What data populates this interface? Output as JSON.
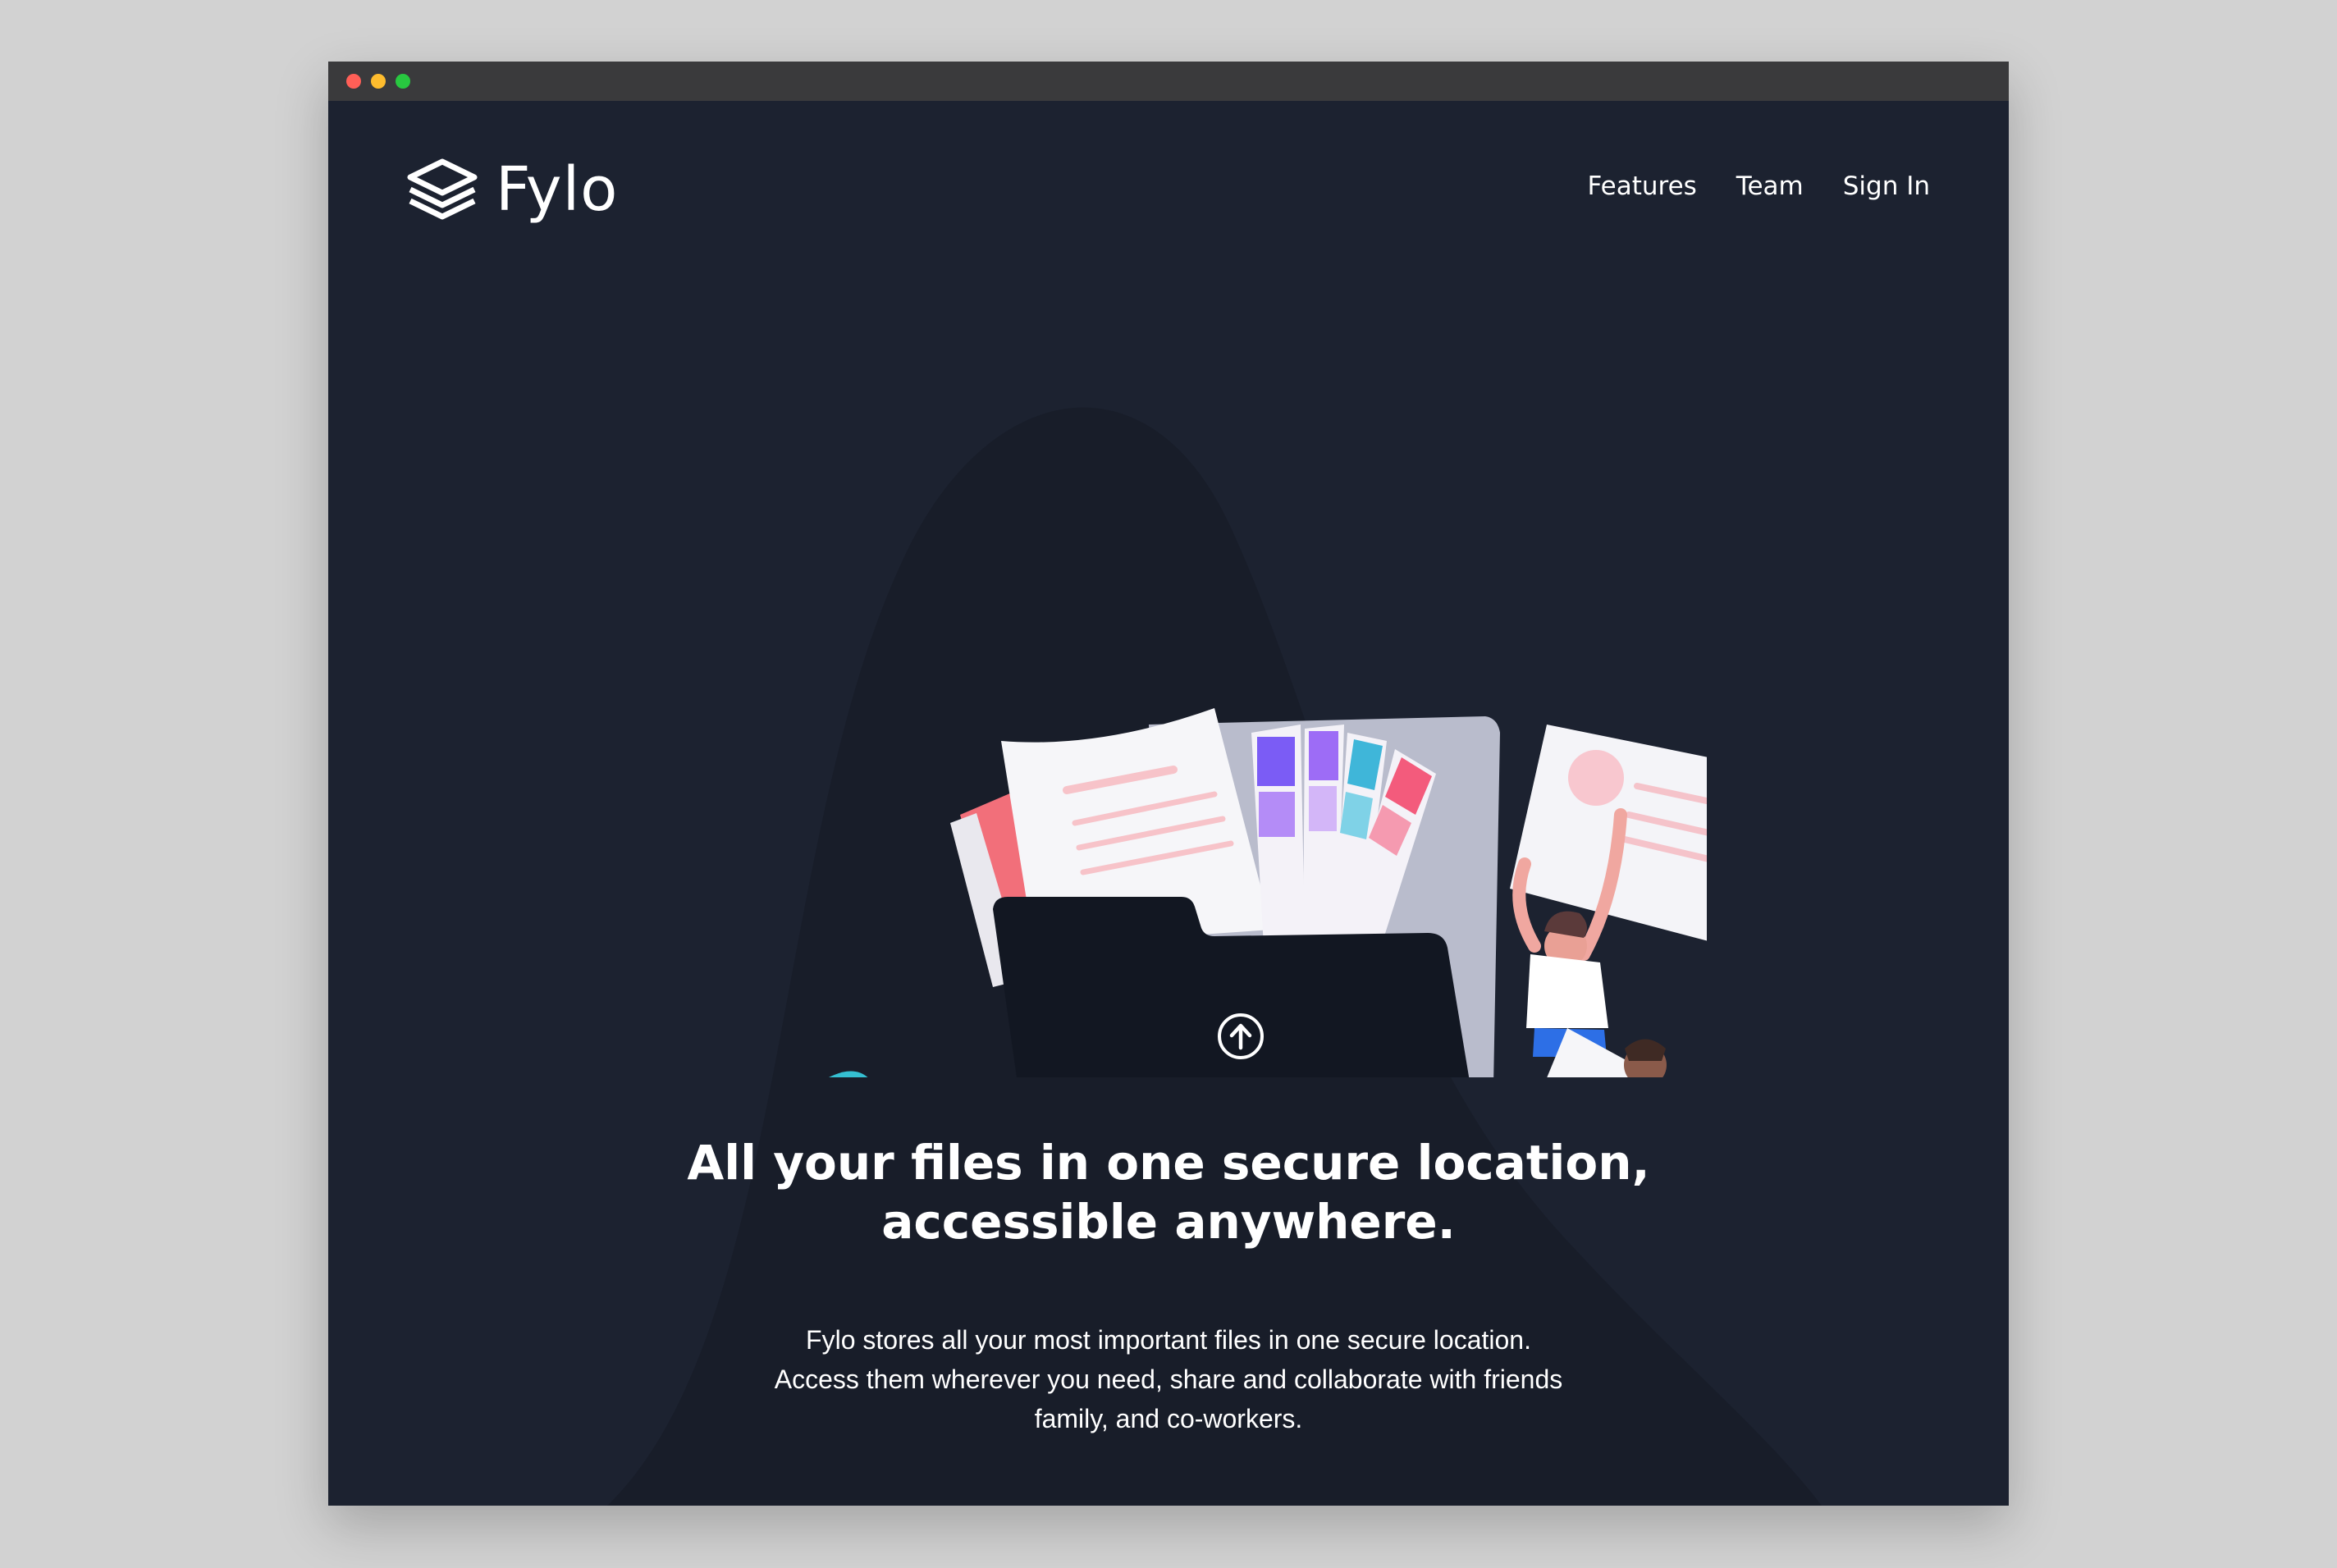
{
  "window": {
    "controls": [
      "close",
      "minimize",
      "maximize"
    ]
  },
  "header": {
    "logo_icon": "stacked-layers-icon",
    "brand": "Fylo",
    "nav": [
      {
        "label": "Features"
      },
      {
        "label": "Team"
      },
      {
        "label": "Sign In"
      }
    ]
  },
  "hero": {
    "illustration": "file-upload-folder-illustration",
    "upload_icon": "upload-arrow-icon",
    "headline_line1": "All your files in one secure location,",
    "headline_line2": "accessible anywhere.",
    "description_line1": "Fylo stores all your most important files in one secure location.",
    "description_line2": "Access them wherever you need, share and collaborate with friends",
    "description_line3": "family, and co-workers."
  },
  "colors": {
    "page_bg": "#1c2230",
    "curve_bg": "#181d29",
    "outer_bg": "#d2d2d2",
    "titlebar": "#3a3a3c",
    "text": "#ffffff",
    "accent_teal": "#3fc3d4",
    "accent_pink": "#f0717f"
  }
}
